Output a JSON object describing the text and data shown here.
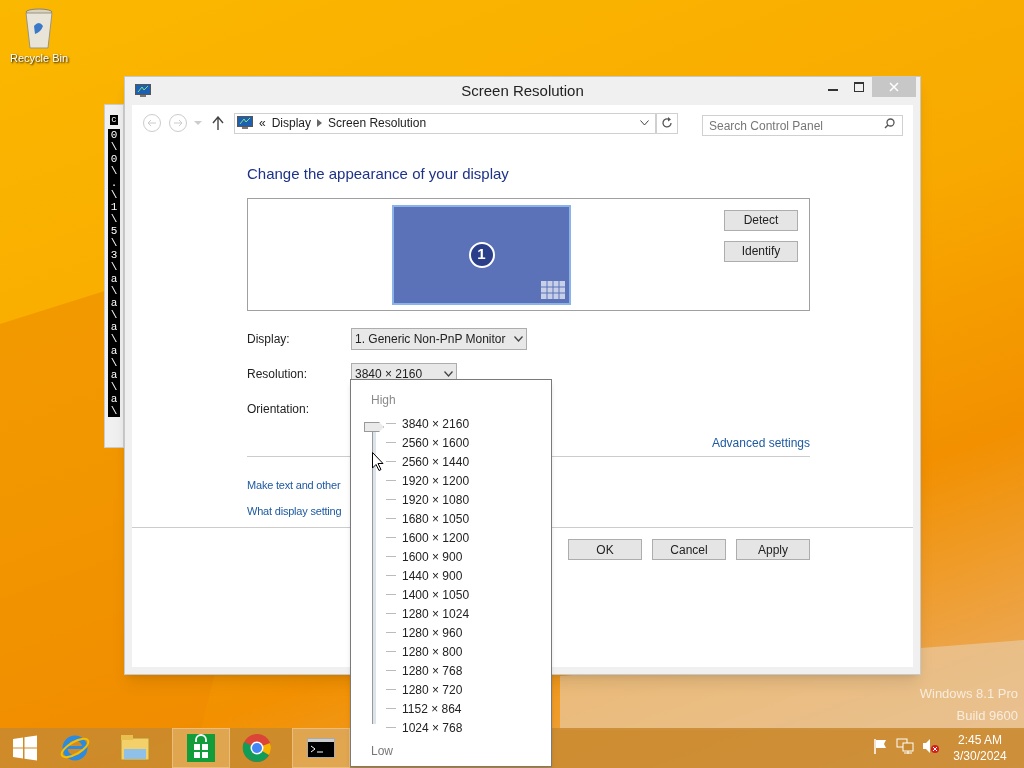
{
  "desktop_icons": [
    {
      "label": "Recycle Bin"
    }
  ],
  "console_window": {
    "header": "c",
    "lines": [
      "0",
      "\\",
      "0",
      "\\",
      ".",
      "\\",
      "1",
      "\\",
      "5",
      "\\",
      "3",
      "\\",
      "a",
      "\\",
      "a",
      "\\",
      "a",
      "\\",
      "a",
      "\\",
      "a",
      "\\",
      "a",
      "\\"
    ]
  },
  "window": {
    "title": "Screen Resolution"
  },
  "address_bar": {
    "prefix": "«",
    "crumbs": [
      "Display",
      "Screen Resolution"
    ]
  },
  "search": {
    "placeholder": "Search Control Panel"
  },
  "heading": "Change the appearance of your display",
  "monitor": {
    "number": "1",
    "selected": true
  },
  "side_buttons": [
    "Detect",
    "Identify"
  ],
  "fields": [
    {
      "label": "Display:",
      "value": "1. Generic Non-PnP Monitor"
    },
    {
      "label": "Resolution:",
      "value": "3840 × 2160"
    },
    {
      "label": "Orientation:"
    }
  ],
  "advanced_link": "Advanced settings",
  "links": [
    "Make text and other",
    "What display setting"
  ],
  "buttons": [
    "OK",
    "Cancel",
    "Apply"
  ],
  "resolution_popup": {
    "high": "High",
    "low": "Low",
    "level": 1,
    "options": [
      "3840 × 2160",
      "2560 × 1600",
      "2560 × 1440",
      "1920 × 1200",
      "1920 × 1080",
      "1680 × 1050",
      "1600 × 1200",
      "1600 × 900",
      "1440 × 900",
      "1400 × 1050",
      "1280 × 1024",
      "1280 × 960",
      "1280 × 800",
      "1280 × 768",
      "1280 × 720",
      "1152 × 864",
      "1024 × 768"
    ]
  },
  "watermark_os": [
    "Windows 8.1 Pro",
    "Build 9600"
  ],
  "taskbar": {
    "items": [
      {
        "kind": "start",
        "active": false
      },
      {
        "kind": "ie",
        "active": false
      },
      {
        "kind": "explorer",
        "active": false
      },
      {
        "kind": "store",
        "active": true
      },
      {
        "kind": "chrome",
        "active": false
      },
      {
        "kind": "cmd",
        "active": true
      }
    ],
    "tray": [
      {
        "kind": "flag"
      },
      {
        "kind": "network"
      },
      {
        "kind": "volume-muted"
      }
    ],
    "time": "2:45 AM",
    "date": "3/30/2024"
  }
}
